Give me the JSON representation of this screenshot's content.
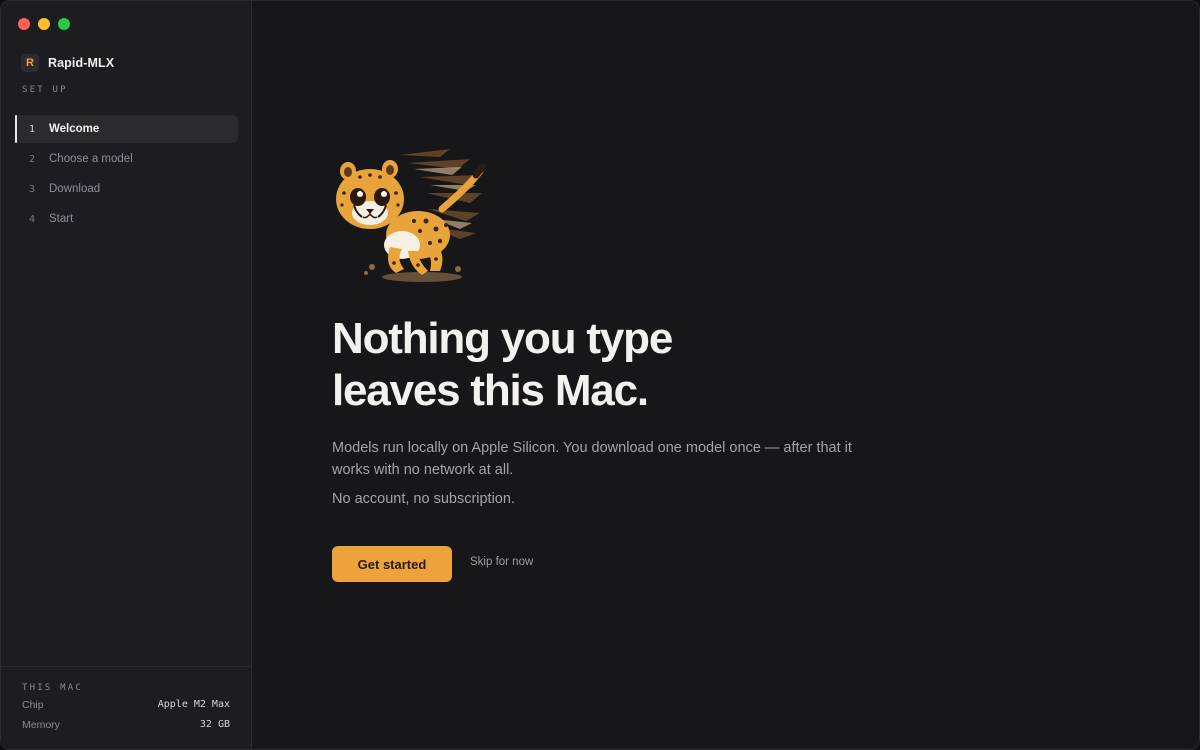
{
  "app": {
    "name": "Rapid-MLX",
    "logo_letter": "R"
  },
  "sidebar": {
    "section_label": "SET UP",
    "steps": [
      {
        "number": "1",
        "label": "Welcome",
        "active": true
      },
      {
        "number": "2",
        "label": "Choose a model",
        "active": false
      },
      {
        "number": "3",
        "label": "Download",
        "active": false
      },
      {
        "number": "4",
        "label": "Start",
        "active": false
      }
    ],
    "mac": {
      "section_label": "THIS MAC",
      "chip_label": "Chip",
      "chip_value": "Apple M2 Max",
      "memory_label": "Memory",
      "memory_value": "32 GB"
    }
  },
  "main": {
    "mascot_icon": "cheetah-mascot-icon",
    "headline_line1": "Nothing you type",
    "headline_line2": "leaves this Mac.",
    "description": "Models run locally on Apple Silicon. You download one model once — after that it works with no network at all.",
    "note": "No account, no subscription.",
    "primary_button": "Get started",
    "skip_link": "Skip for now"
  },
  "colors": {
    "accent": "#eda23c",
    "background": "#17171a",
    "sidebar": "#1d1d21"
  }
}
